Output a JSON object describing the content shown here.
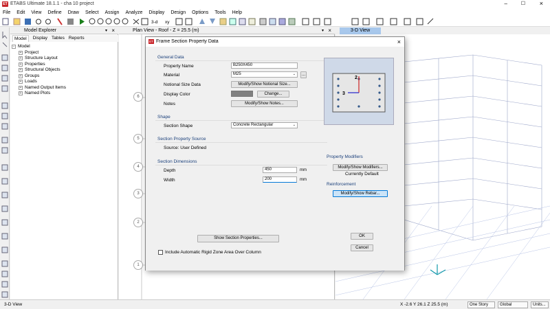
{
  "app": {
    "title": "ETABS Ultimate 18.1.1 - cha 10 project",
    "logo_text": "ET"
  },
  "menu": [
    "File",
    "Edit",
    "View",
    "Define",
    "Draw",
    "Select",
    "Assign",
    "Analyze",
    "Display",
    "Design",
    "Options",
    "Tools",
    "Help"
  ],
  "toolbar": {
    "zoom_3d_label": "3-d",
    "plan_label": "xy"
  },
  "explorer": {
    "title": "Model Explorer",
    "tabs": [
      "Model",
      "Display",
      "Tables",
      "Reports"
    ],
    "root": "Model",
    "items": [
      "Project",
      "Structure Layout",
      "Properties",
      "Structural Objects",
      "Groups",
      "Loads",
      "Named Output Items",
      "Named Plots"
    ]
  },
  "plan_view": {
    "title": "Plan View - Roof - Z = 25.5 (m)",
    "grid_bubbles": [
      "6",
      "5",
      "4",
      "3",
      "2",
      "1"
    ]
  },
  "view3d": {
    "title": "3-D View"
  },
  "dialog": {
    "title": "Frame Section Property Data",
    "general_data": {
      "heading": "General Data",
      "property_name_label": "Property Name",
      "property_name_value": "B250X450",
      "material_label": "Material",
      "material_value": "M25",
      "notional_label": "Notional Size Data",
      "notional_button": "Modify/Show Notional Size...",
      "color_label": "Display Color",
      "color_button": "Change...",
      "notes_label": "Notes",
      "notes_button": "Modify/Show Notes...",
      "material_more": "...",
      "color_swatch": "#808080"
    },
    "shape": {
      "heading": "Shape",
      "label": "Section Shape",
      "value": "Concrete Rectangular"
    },
    "source": {
      "heading": "Section Property Source",
      "text": "Source:  User Defined"
    },
    "dimensions": {
      "heading": "Section Dimensions",
      "depth_label": "Depth",
      "depth_value": "450",
      "depth_unit": "mm",
      "width_label": "Width",
      "width_value": "200",
      "width_unit": "mm"
    },
    "show_props_button": "Show Section Properties...",
    "checkbox_label": "Include Automatic Rigid Zone Area Over Column",
    "preview": {
      "axis2": "2",
      "axis3": "3"
    },
    "modifiers": {
      "heading": "Property Modifiers",
      "button": "Modify/Show Modifiers...",
      "status": "Currently Default"
    },
    "reinforcement": {
      "heading": "Reinforcement",
      "button": "Modify/Show Rebar..."
    },
    "ok": "OK",
    "cancel": "Cancel"
  },
  "status": {
    "left": "3-D View",
    "coords": "X -2.6  Y 26.1  Z 25.5 (m)",
    "story": "One Story",
    "global": "Global",
    "units": "Units..."
  }
}
